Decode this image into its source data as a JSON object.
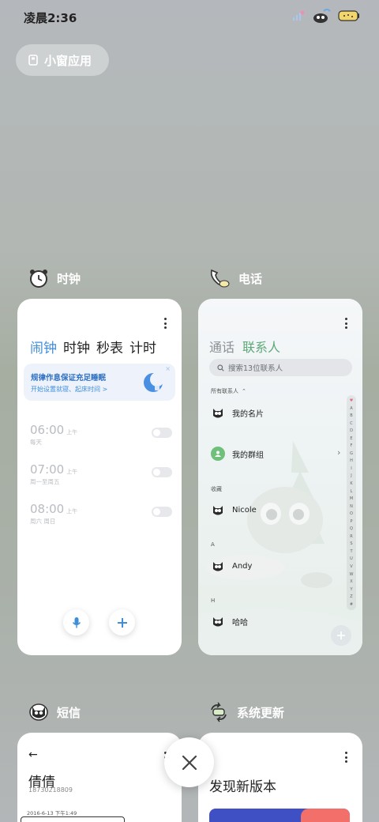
{
  "status": {
    "time": "凌晨2:36"
  },
  "pill": {
    "label": "小窗应用"
  },
  "clock_app": {
    "name": "时钟",
    "tabs": [
      "闹钟",
      "时钟",
      "秒表",
      "计时"
    ],
    "banner": {
      "title": "规律作息保证充足睡眠",
      "subtitle": "开始设置就寝、起床时间 >"
    },
    "alarms": [
      {
        "time": "06:00",
        "ampm": "上午",
        "days": "每天"
      },
      {
        "time": "07:00",
        "ampm": "上午",
        "days": "周一至周五"
      },
      {
        "time": "08:00",
        "ampm": "上午",
        "days": "周六 周日"
      }
    ]
  },
  "phone_app": {
    "name": "电话",
    "tabs": [
      "通话",
      "联系人"
    ],
    "search_placeholder": "搜索13位联系人",
    "all_contacts_label": "所有联系人",
    "my_card": "我的名片",
    "my_groups": "我的群组",
    "favorites_label": "收藏",
    "favorite_contact": "Nicole",
    "section_a": "A",
    "contact_a": "Andy",
    "section_h": "H",
    "contact_h": "哈哈",
    "alphabet": [
      "♥",
      "A",
      "B",
      "C",
      "D",
      "E",
      "F",
      "G",
      "H",
      "I",
      "J",
      "K",
      "L",
      "M",
      "N",
      "O",
      "P",
      "Q",
      "R",
      "S",
      "T",
      "U",
      "V",
      "W",
      "X",
      "Y",
      "Z",
      "#"
    ]
  },
  "sms_app": {
    "name": "短信",
    "contact_name": "倩倩",
    "contact_number": "18730218809",
    "timestamp": "2016-6-13 下午1:49"
  },
  "update_app": {
    "name": "系统更新",
    "title": "发现新版本"
  },
  "colors": {
    "accent_blue": "#3f8ed9",
    "accent_green": "#5ea87a"
  }
}
